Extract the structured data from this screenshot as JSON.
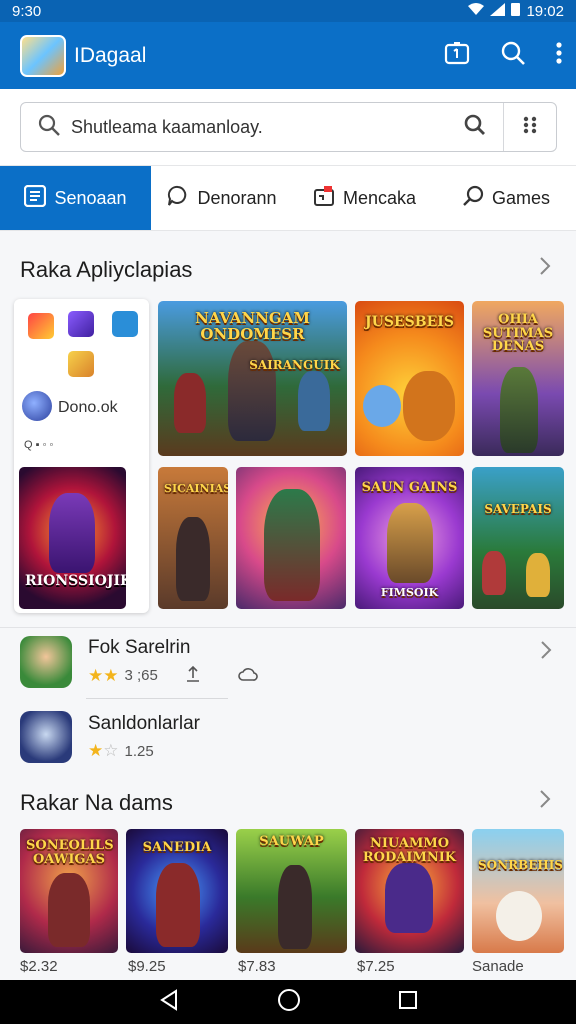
{
  "status": {
    "left": "9:30",
    "time": "19:02"
  },
  "appbar": {
    "title": "IDagaal"
  },
  "search": {
    "placeholder": "Shutleama kaamanloay."
  },
  "tabs": [
    {
      "label": "Senoaan"
    },
    {
      "label": "Denorann"
    },
    {
      "label": "Mencaka"
    },
    {
      "label": "Games"
    }
  ],
  "section1": {
    "title": "Raka Apliyclapias",
    "left_card": {
      "app_name": "Dono.ok",
      "tag": "Q ▪ ◦ ◦",
      "feature_caption": "RIONSSIOJIK"
    },
    "tiles": [
      {
        "caption": "NAVANNGAM ONDOMESR",
        "sub": "SAIRANGUIK"
      },
      {
        "caption": "JUSESBEIS"
      },
      {
        "caption": "OHIA SUTIMAS DENAS"
      },
      {
        "caption": "SICAINIAS"
      },
      {
        "caption": ""
      },
      {
        "caption": "SAUN GAINS",
        "sub": "FIMSOIK"
      },
      {
        "caption": "SAVEPAIS"
      }
    ]
  },
  "list": [
    {
      "name": "Fok Sarelrin",
      "rating": "3 ;65"
    },
    {
      "name": "Sanldonlarlar",
      "rating": "1.25"
    }
  ],
  "section2": {
    "title": "Rakar Na dams",
    "items": [
      {
        "caption": "SONEOLILS OAWIGAS",
        "price": "$2.32"
      },
      {
        "caption": "SANEDIA",
        "price": "$9.25"
      },
      {
        "caption": "SAUWAP",
        "price": "$7.83"
      },
      {
        "caption": "NIUAMMO RODAIMNIK",
        "price": "$7.25"
      },
      {
        "caption": "SONRBEHIS",
        "price": "Sanade"
      }
    ]
  }
}
